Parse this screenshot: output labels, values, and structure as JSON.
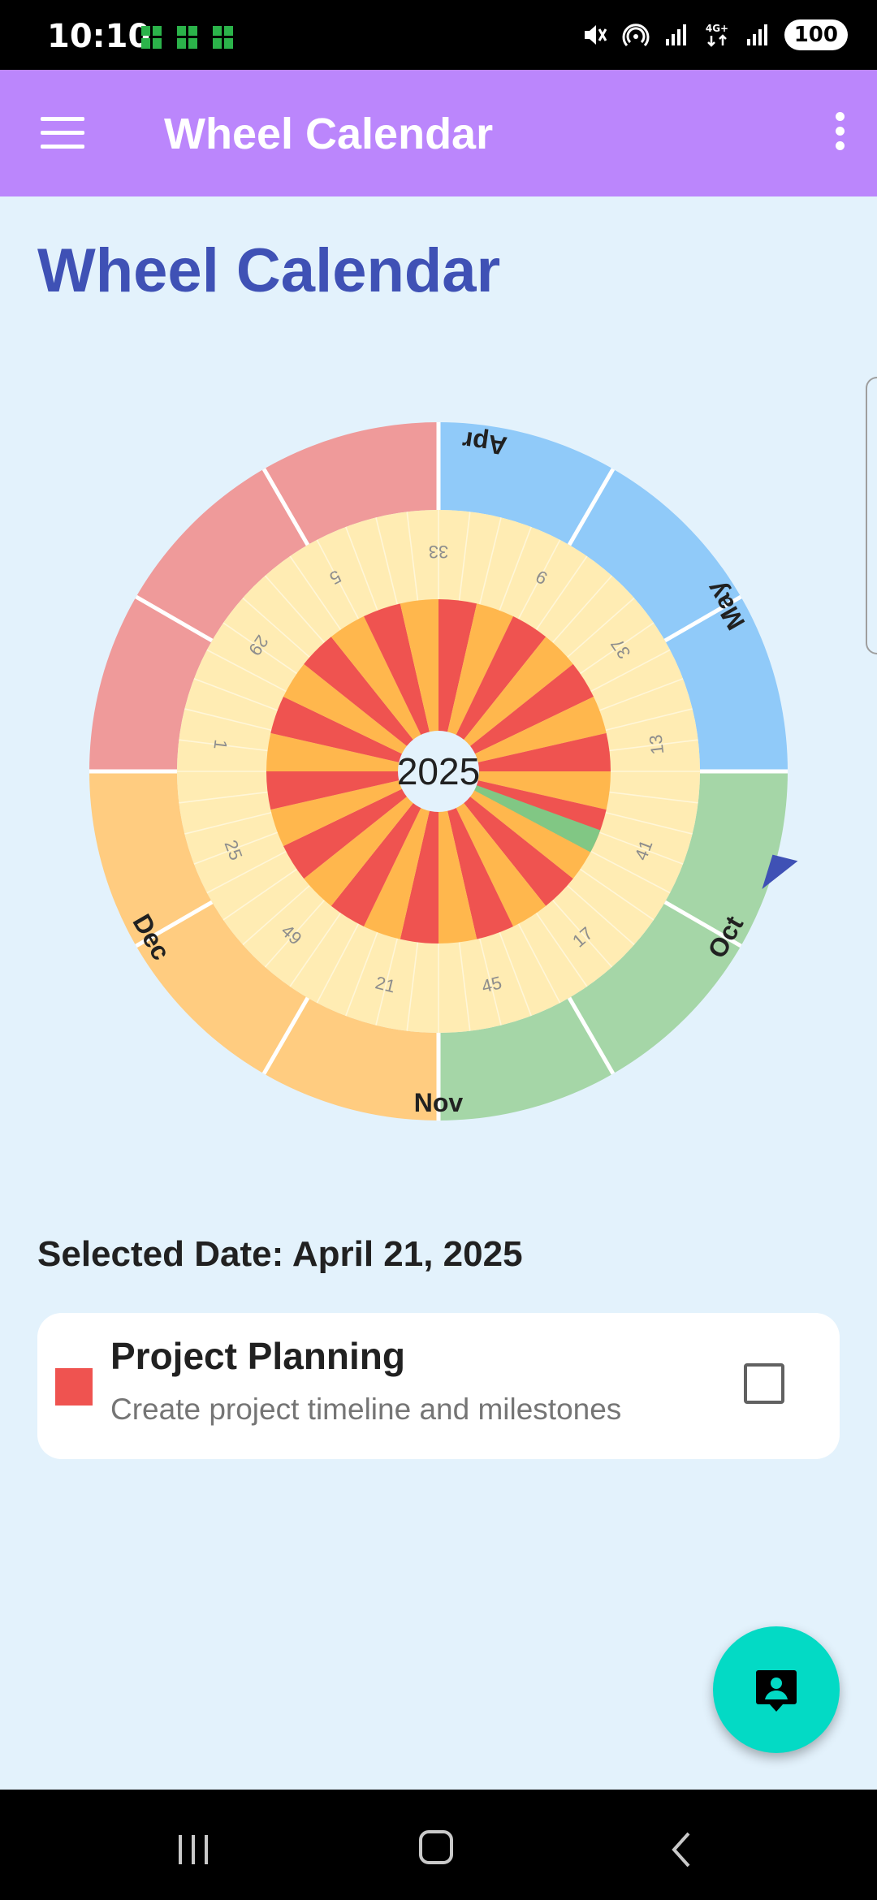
{
  "status_bar": {
    "time": "10:10",
    "left_icons": [
      "app-notification-icon",
      "app-notification-icon",
      "app-notification-icon"
    ],
    "right_icons": [
      "mute-icon",
      "hotspot-icon",
      "signal-icon",
      "4g-data-icon",
      "signal-icon"
    ],
    "network_label": "4G+",
    "battery": "100"
  },
  "app_bar": {
    "title": "Wheel Calendar",
    "color": "#bb86fc"
  },
  "page": {
    "heading": "Wheel Calendar",
    "heading_color": "#3f51b5",
    "background": "#e3f2fc"
  },
  "wheel": {
    "year": "2025",
    "month_labels": [
      {
        "text": "Apr"
      },
      {
        "text": "May"
      },
      {
        "text": "Oct"
      },
      {
        "text": "Nov"
      },
      {
        "text": "Dec"
      }
    ],
    "week_labels": [
      {
        "text": "33"
      },
      {
        "text": "9"
      },
      {
        "text": "37"
      },
      {
        "text": "13"
      },
      {
        "text": "41"
      },
      {
        "text": "17"
      },
      {
        "text": "45"
      },
      {
        "text": "21"
      },
      {
        "text": "49"
      },
      {
        "text": "25"
      },
      {
        "text": "1"
      },
      {
        "text": "29"
      },
      {
        "text": "5"
      }
    ],
    "quarter_colors": [
      "#90caf9",
      "#a5d6a7",
      "#ffcc80",
      "#ef9a9a"
    ],
    "week_ring_color": "#ffecb3",
    "day_colors": [
      "#ef5350",
      "#ffb74d"
    ],
    "highlight_color": "#81c784",
    "marker_color": "#3f51b5"
  },
  "selection": {
    "label": "Selected Date: April 21, 2025"
  },
  "task": {
    "title": "Project Planning",
    "description": "Create project timeline and milestones",
    "color": "#ef5350",
    "completed": false
  },
  "fab": {
    "icon": "contact-support-icon",
    "color": "#03dac5"
  },
  "nav_bar": {
    "icons": [
      "recents-icon",
      "home-icon",
      "back-icon"
    ]
  }
}
